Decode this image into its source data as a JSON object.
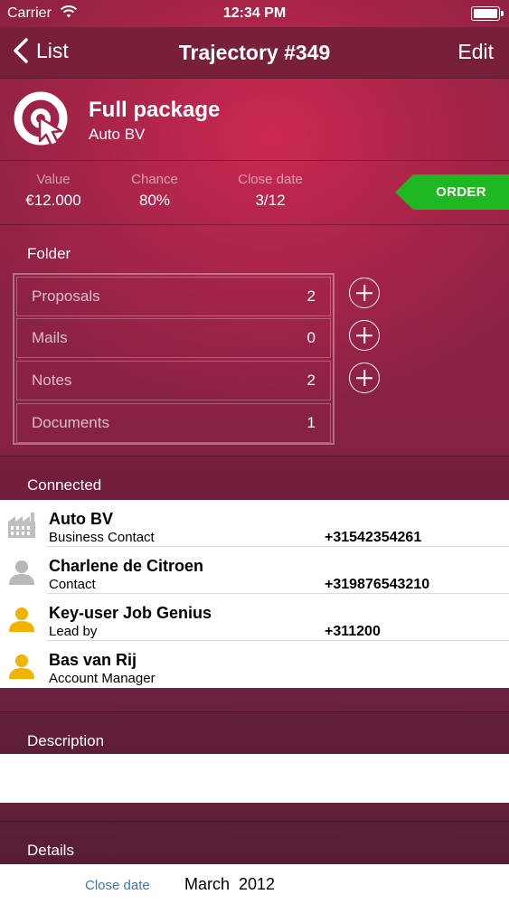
{
  "status_bar": {
    "carrier": "Carrier",
    "time": "12:34 PM"
  },
  "nav": {
    "back_label": "List",
    "title": "Trajectory #349",
    "edit_label": "Edit"
  },
  "header": {
    "title": "Full package",
    "subtitle": "Auto BV"
  },
  "stats": [
    {
      "label": "Value",
      "value": "€12.000"
    },
    {
      "label": "Chance",
      "value": "80%"
    },
    {
      "label": "Close date",
      "value": "3/12"
    }
  ],
  "order_label": "ORDER",
  "folder": {
    "heading": "Folder",
    "items": [
      {
        "label": "Proposals",
        "count": "2"
      },
      {
        "label": "Mails",
        "count": "0"
      },
      {
        "label": "Notes",
        "count": "2"
      },
      {
        "label": "Documents",
        "count": "1"
      }
    ]
  },
  "connected": {
    "heading": "Connected",
    "items": [
      {
        "name": "Auto BV",
        "role": "Business Contact",
        "phone": "+31542354261",
        "icon": "factory-icon"
      },
      {
        "name": "Charlene de Citroen",
        "role": "Contact",
        "phone": "+319876543210",
        "icon": "person-gray-icon"
      },
      {
        "name": "Key-user Job Genius",
        "role": "Lead by",
        "phone": "+311200",
        "icon": "person-yellow-icon"
      },
      {
        "name": "Bas van Rij",
        "role": "Account Manager",
        "phone": "",
        "icon": "person-yellow-icon"
      }
    ]
  },
  "description": {
    "heading": "Description"
  },
  "details": {
    "heading": "Details",
    "label": "Close date",
    "value": "March  2012"
  },
  "colors": {
    "order_green": "#1fb722",
    "link_blue": "#3a78b0"
  }
}
